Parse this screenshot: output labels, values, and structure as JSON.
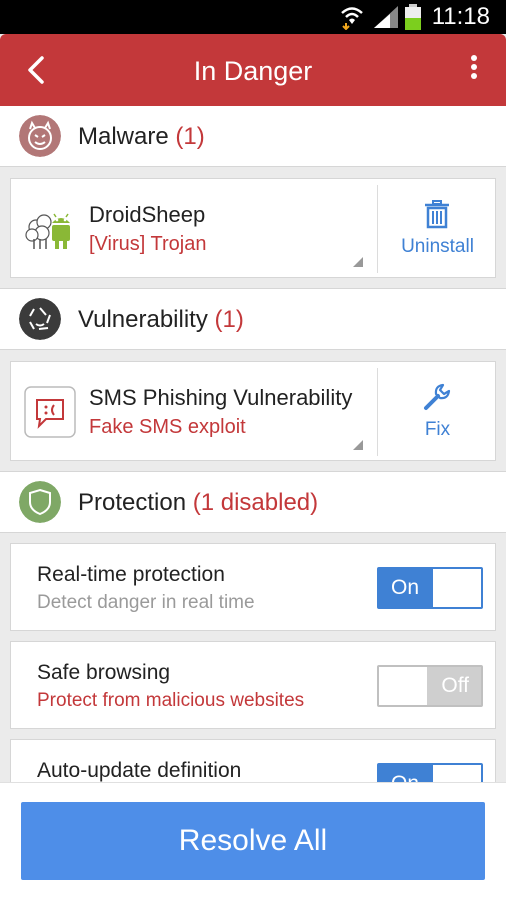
{
  "status_bar": {
    "time": "11:18",
    "icons": [
      "wifi-icon",
      "signal-icon",
      "battery-icon"
    ]
  },
  "app_bar": {
    "title": "In Danger",
    "icons": [
      "back-arrow-icon",
      "overflow-menu-icon"
    ]
  },
  "sections": {
    "malware": {
      "label": "Malware",
      "count": "(1)",
      "icon": "devil-icon",
      "icon_color": "#b27777",
      "items": [
        {
          "name": "DroidSheep",
          "type": "[Virus] Trojan",
          "icon": "sheep-android-icon",
          "action_label": "Uninstall",
          "action_icon": "trash-icon"
        }
      ]
    },
    "vulnerability": {
      "label": "Vulnerability",
      "count": "(1)",
      "icon": "aperture-icon",
      "icon_color": "#3b3b3b",
      "items": [
        {
          "name": "SMS Phishing Vulnerability",
          "type": "Fake SMS exploit",
          "icon": "sad-message-icon",
          "action_label": "Fix",
          "action_icon": "wrench-icon"
        }
      ]
    },
    "protection": {
      "label": "Protection",
      "count": "(1 disabled)",
      "icon": "shield-icon",
      "icon_color": "#7fa866",
      "items": [
        {
          "title": "Real-time protection",
          "desc": "Detect danger in real time",
          "toggle": "On"
        },
        {
          "title": "Safe browsing",
          "desc": "Protect from malicious websites",
          "toggle": "Off"
        },
        {
          "title": "Auto-update definition",
          "desc": "",
          "toggle": "On"
        }
      ]
    }
  },
  "footer": {
    "resolve_label": "Resolve All"
  },
  "colors": {
    "app_bar": "#c3383a",
    "accent_red": "#c3383a",
    "accent_blue": "#3f81d4",
    "resolve_button": "#4e8ee8"
  }
}
